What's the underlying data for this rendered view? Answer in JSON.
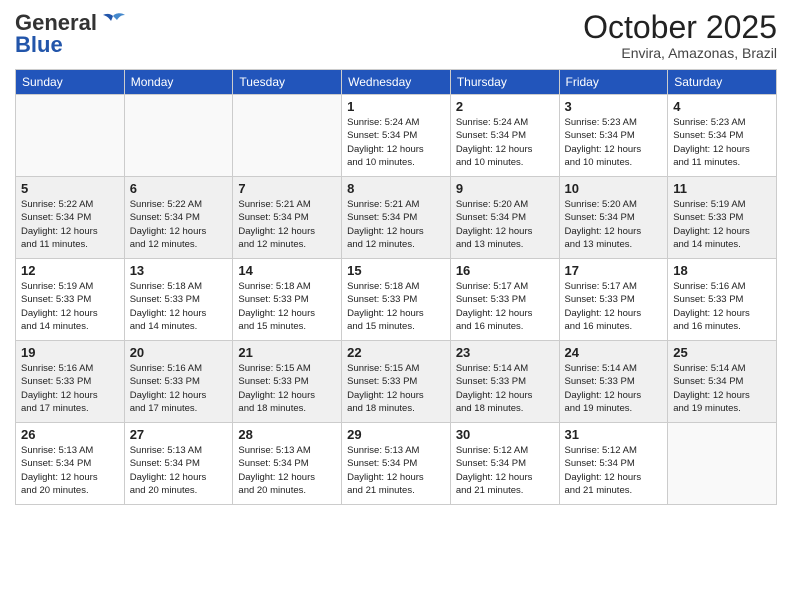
{
  "header": {
    "logo_general": "General",
    "logo_blue": "Blue",
    "month": "October 2025",
    "location": "Envira, Amazonas, Brazil"
  },
  "weekdays": [
    "Sunday",
    "Monday",
    "Tuesday",
    "Wednesday",
    "Thursday",
    "Friday",
    "Saturday"
  ],
  "weeks": [
    [
      {
        "day": "",
        "info": ""
      },
      {
        "day": "",
        "info": ""
      },
      {
        "day": "",
        "info": ""
      },
      {
        "day": "1",
        "info": "Sunrise: 5:24 AM\nSunset: 5:34 PM\nDaylight: 12 hours\nand 10 minutes."
      },
      {
        "day": "2",
        "info": "Sunrise: 5:24 AM\nSunset: 5:34 PM\nDaylight: 12 hours\nand 10 minutes."
      },
      {
        "day": "3",
        "info": "Sunrise: 5:23 AM\nSunset: 5:34 PM\nDaylight: 12 hours\nand 10 minutes."
      },
      {
        "day": "4",
        "info": "Sunrise: 5:23 AM\nSunset: 5:34 PM\nDaylight: 12 hours\nand 11 minutes."
      }
    ],
    [
      {
        "day": "5",
        "info": "Sunrise: 5:22 AM\nSunset: 5:34 PM\nDaylight: 12 hours\nand 11 minutes."
      },
      {
        "day": "6",
        "info": "Sunrise: 5:22 AM\nSunset: 5:34 PM\nDaylight: 12 hours\nand 12 minutes."
      },
      {
        "day": "7",
        "info": "Sunrise: 5:21 AM\nSunset: 5:34 PM\nDaylight: 12 hours\nand 12 minutes."
      },
      {
        "day": "8",
        "info": "Sunrise: 5:21 AM\nSunset: 5:34 PM\nDaylight: 12 hours\nand 12 minutes."
      },
      {
        "day": "9",
        "info": "Sunrise: 5:20 AM\nSunset: 5:34 PM\nDaylight: 12 hours\nand 13 minutes."
      },
      {
        "day": "10",
        "info": "Sunrise: 5:20 AM\nSunset: 5:34 PM\nDaylight: 12 hours\nand 13 minutes."
      },
      {
        "day": "11",
        "info": "Sunrise: 5:19 AM\nSunset: 5:33 PM\nDaylight: 12 hours\nand 14 minutes."
      }
    ],
    [
      {
        "day": "12",
        "info": "Sunrise: 5:19 AM\nSunset: 5:33 PM\nDaylight: 12 hours\nand 14 minutes."
      },
      {
        "day": "13",
        "info": "Sunrise: 5:18 AM\nSunset: 5:33 PM\nDaylight: 12 hours\nand 14 minutes."
      },
      {
        "day": "14",
        "info": "Sunrise: 5:18 AM\nSunset: 5:33 PM\nDaylight: 12 hours\nand 15 minutes."
      },
      {
        "day": "15",
        "info": "Sunrise: 5:18 AM\nSunset: 5:33 PM\nDaylight: 12 hours\nand 15 minutes."
      },
      {
        "day": "16",
        "info": "Sunrise: 5:17 AM\nSunset: 5:33 PM\nDaylight: 12 hours\nand 16 minutes."
      },
      {
        "day": "17",
        "info": "Sunrise: 5:17 AM\nSunset: 5:33 PM\nDaylight: 12 hours\nand 16 minutes."
      },
      {
        "day": "18",
        "info": "Sunrise: 5:16 AM\nSunset: 5:33 PM\nDaylight: 12 hours\nand 16 minutes."
      }
    ],
    [
      {
        "day": "19",
        "info": "Sunrise: 5:16 AM\nSunset: 5:33 PM\nDaylight: 12 hours\nand 17 minutes."
      },
      {
        "day": "20",
        "info": "Sunrise: 5:16 AM\nSunset: 5:33 PM\nDaylight: 12 hours\nand 17 minutes."
      },
      {
        "day": "21",
        "info": "Sunrise: 5:15 AM\nSunset: 5:33 PM\nDaylight: 12 hours\nand 18 minutes."
      },
      {
        "day": "22",
        "info": "Sunrise: 5:15 AM\nSunset: 5:33 PM\nDaylight: 12 hours\nand 18 minutes."
      },
      {
        "day": "23",
        "info": "Sunrise: 5:14 AM\nSunset: 5:33 PM\nDaylight: 12 hours\nand 18 minutes."
      },
      {
        "day": "24",
        "info": "Sunrise: 5:14 AM\nSunset: 5:33 PM\nDaylight: 12 hours\nand 19 minutes."
      },
      {
        "day": "25",
        "info": "Sunrise: 5:14 AM\nSunset: 5:34 PM\nDaylight: 12 hours\nand 19 minutes."
      }
    ],
    [
      {
        "day": "26",
        "info": "Sunrise: 5:13 AM\nSunset: 5:34 PM\nDaylight: 12 hours\nand 20 minutes."
      },
      {
        "day": "27",
        "info": "Sunrise: 5:13 AM\nSunset: 5:34 PM\nDaylight: 12 hours\nand 20 minutes."
      },
      {
        "day": "28",
        "info": "Sunrise: 5:13 AM\nSunset: 5:34 PM\nDaylight: 12 hours\nand 20 minutes."
      },
      {
        "day": "29",
        "info": "Sunrise: 5:13 AM\nSunset: 5:34 PM\nDaylight: 12 hours\nand 21 minutes."
      },
      {
        "day": "30",
        "info": "Sunrise: 5:12 AM\nSunset: 5:34 PM\nDaylight: 12 hours\nand 21 minutes."
      },
      {
        "day": "31",
        "info": "Sunrise: 5:12 AM\nSunset: 5:34 PM\nDaylight: 12 hours\nand 21 minutes."
      },
      {
        "day": "",
        "info": ""
      }
    ]
  ]
}
